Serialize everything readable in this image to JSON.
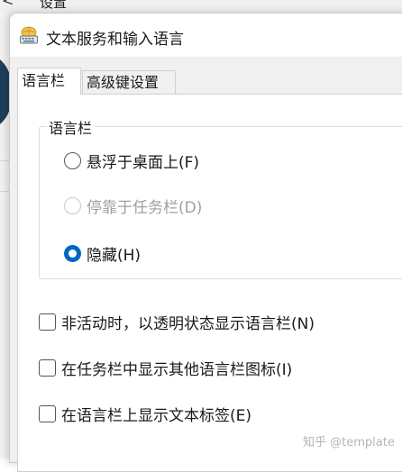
{
  "background_window": {
    "back_glyph": "<",
    "title": "设置"
  },
  "dialog": {
    "title": "文本服务和输入语言",
    "icon": "keyboard-globe-icon"
  },
  "tabs": [
    {
      "label": "语言栏",
      "active": true
    },
    {
      "label": "高级键设置",
      "active": false
    }
  ],
  "language_bar_group": {
    "legend": "语言栏",
    "options": [
      {
        "label": "悬浮于桌面上(F)",
        "checked": false,
        "disabled": false
      },
      {
        "label": "停靠于任务栏(D)",
        "checked": false,
        "disabled": true
      },
      {
        "label": "隐藏(H)",
        "checked": true,
        "disabled": false
      }
    ]
  },
  "checkboxes": [
    {
      "label": "非活动时，以透明状态显示语言栏(N)",
      "checked": false
    },
    {
      "label": "在任务栏中显示其他语言栏图标(I)",
      "checked": false
    },
    {
      "label": "在语言栏上显示文本标签(E)",
      "checked": false
    }
  ],
  "watermark": "知乎 @template",
  "colors": {
    "accent": "#0067c0",
    "dialog_bg": "#f0f0f0",
    "panel_bg": "#ffffff"
  }
}
